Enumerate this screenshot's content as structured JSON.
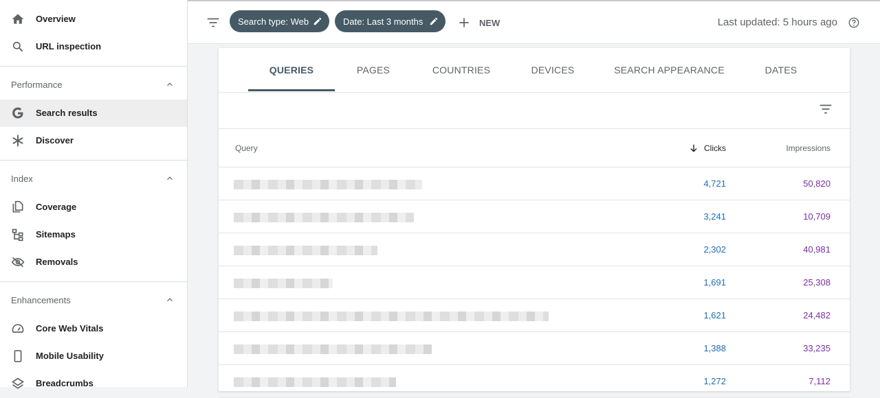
{
  "sidebar": {
    "top_items": [
      {
        "label": "Overview",
        "icon": "home-icon"
      },
      {
        "label": "URL inspection",
        "icon": "search-icon"
      }
    ],
    "sections": [
      {
        "title": "Performance",
        "items": [
          {
            "label": "Search results",
            "icon": "google-g-icon",
            "active": true
          },
          {
            "label": "Discover",
            "icon": "asterisk-icon"
          }
        ]
      },
      {
        "title": "Index",
        "items": [
          {
            "label": "Coverage",
            "icon": "copy-icon"
          },
          {
            "label": "Sitemaps",
            "icon": "sitemap-icon"
          },
          {
            "label": "Removals",
            "icon": "eye-off-icon"
          }
        ]
      },
      {
        "title": "Enhancements",
        "items": [
          {
            "label": "Core Web Vitals",
            "icon": "gauge-icon"
          },
          {
            "label": "Mobile Usability",
            "icon": "phone-icon"
          },
          {
            "label": "Breadcrumbs",
            "icon": "layers-icon"
          }
        ]
      }
    ]
  },
  "topbar": {
    "chips": [
      "Search type: Web",
      "Date: Last 3 months"
    ],
    "new_label": "NEW",
    "last_updated": "Last updated: 5 hours ago"
  },
  "tabs": [
    "QUERIES",
    "PAGES",
    "COUNTRIES",
    "DEVICES",
    "SEARCH APPEARANCE",
    "DATES"
  ],
  "active_tab": "QUERIES",
  "table": {
    "columns": {
      "query": "Query",
      "clicks": "Clicks",
      "impressions": "Impressions"
    },
    "rows": [
      {
        "clicks": "4,721",
        "impressions": "50,820"
      },
      {
        "clicks": "3,241",
        "impressions": "10,709"
      },
      {
        "clicks": "2,302",
        "impressions": "40,981"
      },
      {
        "clicks": "1,691",
        "impressions": "25,308"
      },
      {
        "clicks": "1,621",
        "impressions": "24,482"
      },
      {
        "clicks": "1,388",
        "impressions": "33,235"
      },
      {
        "clicks": "1,272",
        "impressions": "7,112"
      }
    ]
  },
  "colors": {
    "accent": "#455a64",
    "clicks": "#1f6fb5",
    "impressions": "#7b2fa3"
  }
}
